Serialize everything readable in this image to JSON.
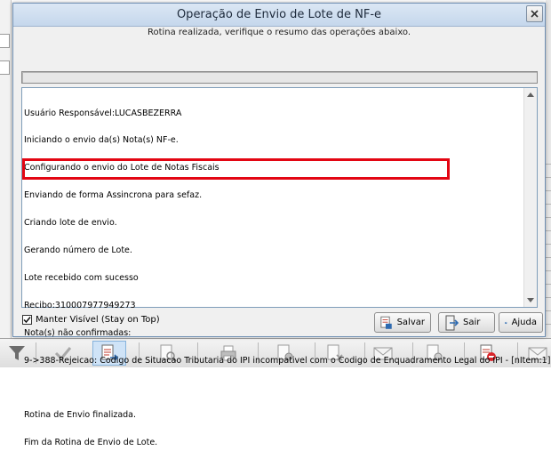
{
  "dialog": {
    "title": "Operação de Envio de Lote de NF-e",
    "message": "Rotina realizada, verifique o resumo das operações abaixo.",
    "log_lines": [
      "Usuário Responsável:LUCASBEZERRA",
      "Iniciando o envio da(s) Nota(s) NF-e.",
      "Configurando o envio do Lote de Notas Fiscais",
      "Enviando de forma Assincrona para sefaz.",
      "Criando lote de envio.",
      "Gerando número de Lote.",
      "Lote recebido com sucesso",
      "Recibo:310007977949273",
      "Nota(s) não confirmadas:",
      "9->388-Rejeicao: Codigo de Situacao Tributaria do IPI incompativel com o Codigo de Enquadramento Legal do IPI - [nItem:1]",
      "",
      "Rotina de Envio finalizada.",
      "Fim da Rotina de Envio de Lote."
    ],
    "keep_visible_label": "Manter Visível (Stay on Top)",
    "keep_visible_checked": true,
    "buttons": {
      "save": "Salvar",
      "exit": "Sair",
      "help": "Ajuda"
    }
  },
  "colors": {
    "highlight": "#e30613",
    "title_bar": "#c5d7ec"
  },
  "toolbar_icons": [
    "filter-icon",
    "check-icon",
    "send-document-icon",
    "search-document-icon",
    "print-icon",
    "settings-document-icon",
    "document-x-icon",
    "email-icon",
    "document-info-icon",
    "cancel-document-icon",
    "email-send-icon"
  ]
}
